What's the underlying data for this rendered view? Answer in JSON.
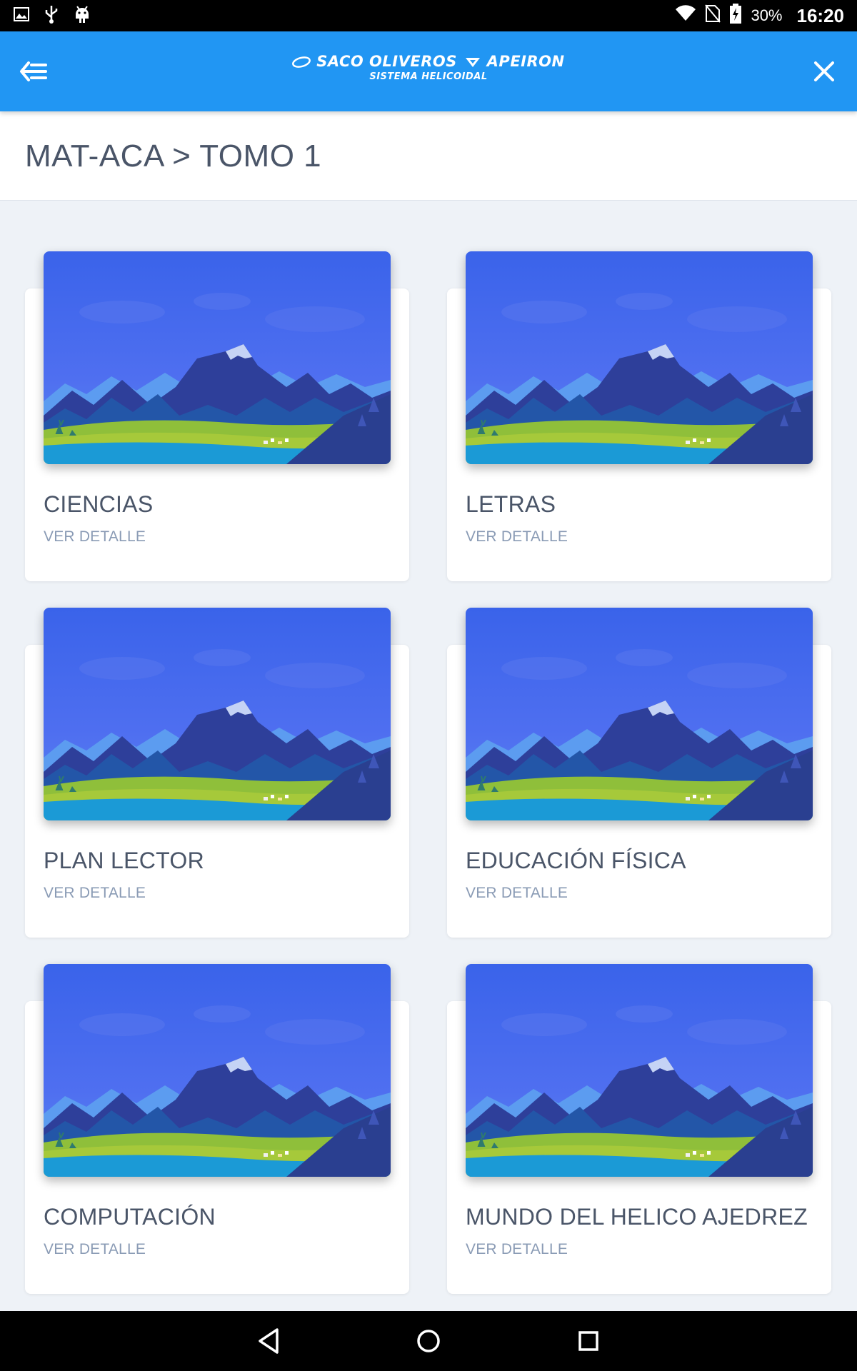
{
  "status_bar": {
    "battery_percent": "30%",
    "time": "16:20",
    "icons": [
      "image-icon",
      "usb-icon",
      "android-icon",
      "wifi-icon",
      "no-sim-icon",
      "battery-charging-icon"
    ]
  },
  "app_bar": {
    "back_icon": "back-arrow-menu-icon",
    "close_icon": "close-icon",
    "logo": {
      "brand_left": "SACO OLIVEROS",
      "brand_right": "APEIRON",
      "subtitle": "SISTEMA HELICOIDAL"
    },
    "background_color": "#2196f3"
  },
  "breadcrumb": {
    "text": "MAT-ACA > TOMO 1"
  },
  "cards": [
    {
      "title": "CIENCIAS",
      "link": "VER DETALLE"
    },
    {
      "title": "LETRAS",
      "link": "VER DETALLE"
    },
    {
      "title": "PLAN LECTOR",
      "link": "VER DETALLE"
    },
    {
      "title": "EDUCACIÓN FÍSICA",
      "link": "VER DETALLE"
    },
    {
      "title": "COMPUTACIÓN",
      "link": "VER DETALLE"
    },
    {
      "title": "MUNDO DEL HELICO AJEDREZ",
      "link": "VER DETALLE"
    }
  ],
  "nav_bar": {
    "icons": [
      "back-triangle-icon",
      "home-circle-icon",
      "recents-square-icon"
    ]
  }
}
